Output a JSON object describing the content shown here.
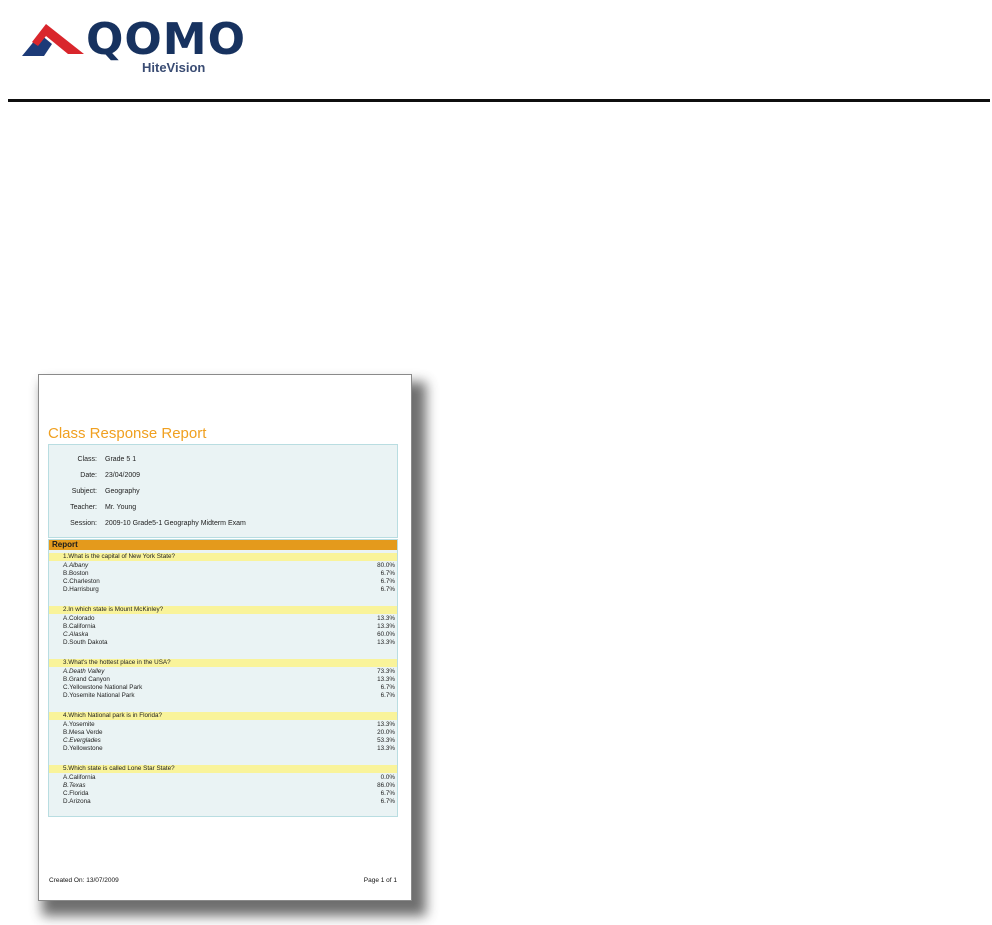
{
  "brand": {
    "name": "QOMO",
    "sub": "HiteVision",
    "colors": {
      "red": "#d9262c",
      "navy": "#17325f"
    }
  },
  "report": {
    "title": "Class Response Report",
    "info": [
      {
        "label": "Class:",
        "value": "Grade 5 1"
      },
      {
        "label": "Date:",
        "value": "23/04/2009"
      },
      {
        "label": "Subject:",
        "value": "Geography"
      },
      {
        "label": "Teacher:",
        "value": "Mr. Young"
      },
      {
        "label": "Session:",
        "value": "2009-10 Grade5-1 Geography Midterm Exam"
      }
    ],
    "section_title": "Report",
    "questions": [
      {
        "text": "1.What is the capital of New York State?",
        "answers": [
          {
            "label": "A.Albany",
            "pct": "80.0%"
          },
          {
            "label": "B.Boston",
            "pct": "6.7%"
          },
          {
            "label": "C.Charleston",
            "pct": "6.7%"
          },
          {
            "label": "D.Harrisburg",
            "pct": "6.7%"
          }
        ]
      },
      {
        "text": "2.In which state is Mount McKinley?",
        "answers": [
          {
            "label": "A.Colorado",
            "pct": "13.3%"
          },
          {
            "label": "B.California",
            "pct": "13.3%"
          },
          {
            "label": "C.Alaska",
            "pct": "60.0%"
          },
          {
            "label": "D.South Dakota",
            "pct": "13.3%"
          }
        ]
      },
      {
        "text": "3.What's the hottest place in the USA?",
        "answers": [
          {
            "label": "A.Death Valley",
            "pct": "73.3%"
          },
          {
            "label": "B.Grand Canyon",
            "pct": "13.3%"
          },
          {
            "label": "C.Yellowstone National Park",
            "pct": "6.7%"
          },
          {
            "label": "D.Yosemite National Park",
            "pct": "6.7%"
          }
        ]
      },
      {
        "text": "4.Which National park is in Florida?",
        "answers": [
          {
            "label": "A.Yosemite",
            "pct": "13.3%"
          },
          {
            "label": "B.Mesa Verde",
            "pct": "20.0%"
          },
          {
            "label": "C.Everglades",
            "pct": "53.3%"
          },
          {
            "label": "D.Yellowstone",
            "pct": "13.3%"
          }
        ]
      },
      {
        "text": "5.Which state is called Lone Star State?",
        "answers": [
          {
            "label": "A.California",
            "pct": "0.0%"
          },
          {
            "label": "B.Texas",
            "pct": "86.0%"
          },
          {
            "label": "C.Florida",
            "pct": "6.7%"
          },
          {
            "label": "D.Arizona",
            "pct": "6.7%"
          }
        ]
      }
    ],
    "footer": {
      "created": "Created On: 13/07/2009",
      "page": "Page 1 of 1"
    },
    "colors": {
      "title": "#f0a020",
      "section": "#e49a1c",
      "question": "#f9f39a",
      "panel": "#eaf3f4"
    }
  }
}
